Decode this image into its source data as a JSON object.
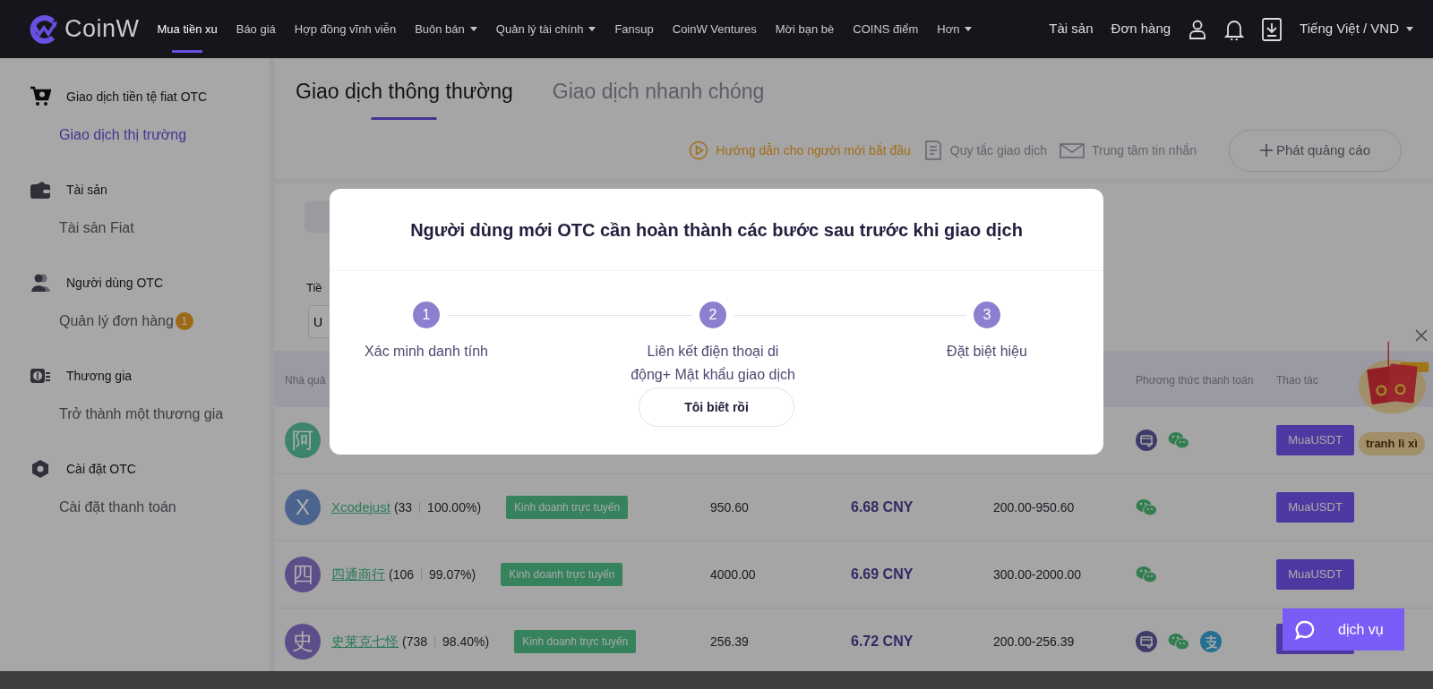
{
  "navbar": {
    "logo": "CoinW",
    "items": [
      {
        "label": "Mua tiền xu",
        "selected": true,
        "dropdown": false
      },
      {
        "label": "Báo giá",
        "selected": false,
        "dropdown": false
      },
      {
        "label": "Hợp đồng vĩnh viễn",
        "selected": false,
        "dropdown": false
      },
      {
        "label": "Buôn bán",
        "selected": false,
        "dropdown": true
      },
      {
        "label": "Quản lý tài chính",
        "selected": false,
        "dropdown": true
      },
      {
        "label": "Fansup",
        "selected": false,
        "dropdown": false
      },
      {
        "label": "CoinW Ventures",
        "selected": false,
        "dropdown": false
      },
      {
        "label": "Mời bạn bè",
        "selected": false,
        "dropdown": false
      },
      {
        "label": "COINS điểm",
        "selected": false,
        "dropdown": false
      },
      {
        "label": "Hơn",
        "selected": false,
        "dropdown": true
      }
    ],
    "account_links": [
      "Tài sản",
      "Đơn hàng"
    ],
    "language": "Tiếng Việt / VND"
  },
  "sidebar": [
    {
      "kind": "cart",
      "title": "Giao dịch tiền tệ fiat OTC",
      "items": [
        {
          "label": "Giao dịch thị trường",
          "selected": true
        }
      ]
    },
    {
      "kind": "wallet",
      "title": "Tài sản",
      "items": [
        {
          "label": "Tài sản Fiat",
          "selected": false
        }
      ]
    },
    {
      "kind": "users",
      "title": "Người dùng OTC",
      "items": [
        {
          "label": "Quản lý đơn hàng",
          "selected": false,
          "badge": "1"
        }
      ]
    },
    {
      "kind": "merchant",
      "title": "Thương gia",
      "items": [
        {
          "label": "Trở thành một thương gia",
          "selected": false
        }
      ]
    },
    {
      "kind": "settings",
      "title": "Cài đặt OTC",
      "items": [
        {
          "label": "Cài đặt thanh toán",
          "selected": false
        }
      ]
    }
  ],
  "tabs": [
    {
      "label": "Giao dịch thông thường",
      "selected": true
    },
    {
      "label": "Giao dịch nhanh chóng",
      "selected": false
    }
  ],
  "toolbar": {
    "links": [
      {
        "kind": "guide",
        "label": "Hướng dẫn cho người mới bắt đầu"
      },
      {
        "kind": "rules",
        "label": "Quy tắc giao dịch"
      },
      {
        "kind": "messages",
        "label": "Trung tâm tin nhắn"
      }
    ],
    "post_button": "Phát quảng cáo"
  },
  "filters": {
    "label": "Tiề",
    "currency_value": "U"
  },
  "table": {
    "columns": {
      "merchant": "Nhà quả",
      "payment": "Phương thức thanh toán",
      "action": "Thao tác"
    },
    "rows": [
      {
        "avatar": "阿",
        "color": "#3d856a",
        "payments": [
          {
            "kind": "card"
          },
          {
            "kind": "wechat"
          }
        ],
        "action": "MuaUSDT"
      },
      {
        "avatar": "X",
        "color": "#4a648d",
        "name": "Xcodejust",
        "orders": "(33",
        "rate": "100.00%)",
        "tag": "Kinh doanh trực tuyến",
        "amount": "950.60",
        "price": "6.68 CNY",
        "limit": "200.00-950.60",
        "payments": [
          {
            "kind": "wechat"
          }
        ],
        "action": "MuaUSDT"
      },
      {
        "avatar": "四",
        "color": "#5c4e89",
        "name": "四通商行",
        "orders": "(106",
        "rate": "99.07%)",
        "tag": "Kinh doanh trực tuyến",
        "amount": "4000.00",
        "price": "6.69 CNY",
        "limit": "300.00-2000.00",
        "payments": [
          {
            "kind": "wechat"
          }
        ],
        "action": "MuaUSDT"
      },
      {
        "avatar": "史",
        "color": "#5c4e89",
        "name": "史莱克七怪",
        "orders": "(738",
        "rate": "98.40%)",
        "tag": "Kinh doanh trực tuyến",
        "amount": "256.39",
        "price": "6.72 CNY",
        "limit": "200.00-256.39",
        "payments": [
          {
            "kind": "card"
          },
          {
            "kind": "wechat"
          },
          {
            "kind": "alipay"
          }
        ],
        "action_covered": true
      }
    ]
  },
  "dialog": {
    "title": "Người dùng mới OTC cần hoàn thành các bước sau trước khi giao dịch",
    "steps": [
      {
        "number": "1",
        "label": "Xác minh danh tính"
      },
      {
        "number": "2",
        "label": "Liên kết điện thoại di động+ Mật khẩu giao dịch"
      },
      {
        "number": "3",
        "label": "Đặt biệt hiệu"
      }
    ],
    "confirm": "Tôi biết rồi"
  },
  "promo": {
    "label": "tranh lì xì"
  },
  "chat_button": {
    "label": "dịch vụ"
  }
}
